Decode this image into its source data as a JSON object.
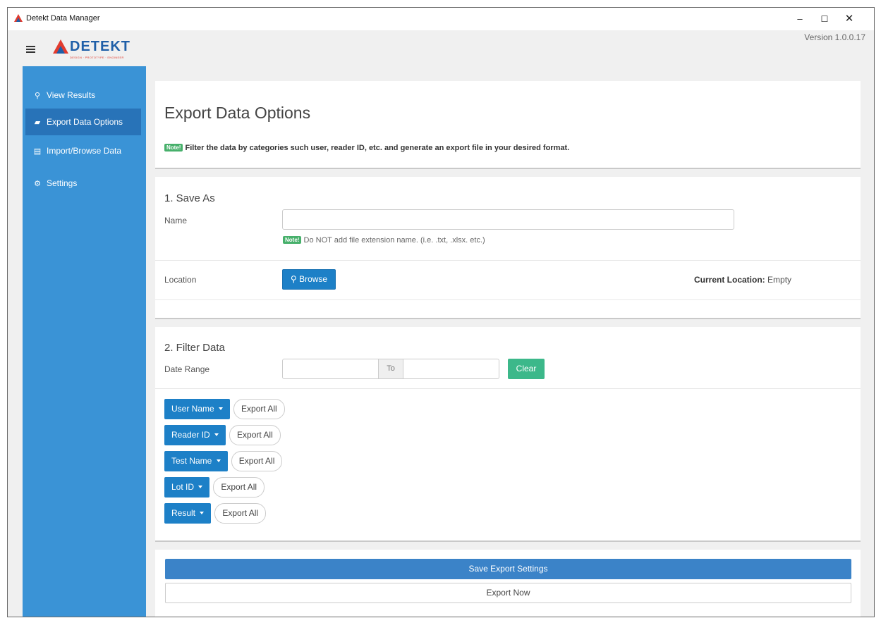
{
  "window": {
    "title": "Detekt Data Manager",
    "minimize_glyph": "–",
    "maximize_glyph": "☐",
    "close_glyph": "✕"
  },
  "header": {
    "logo_text": "DETEKT",
    "logo_tagline": "DESIGN · PROTOTYPE · ENGINEER",
    "version": "Version 1.0.0.17"
  },
  "sidebar": {
    "items": [
      {
        "label": "View Results",
        "icon": "search-icon",
        "glyph": "⚲"
      },
      {
        "label": "Export Data Options",
        "icon": "book-icon",
        "glyph": "▰",
        "active": true
      },
      {
        "label": "Import/Browse Data",
        "icon": "database-icon",
        "glyph": "▤"
      },
      {
        "label": "Settings",
        "icon": "gear-icon",
        "glyph": "⚙"
      }
    ]
  },
  "main": {
    "title": "Export Data Options",
    "note_badge": "Note!",
    "note_text": "Filter the data by categories such user, reader ID, etc. and generate an export file in your desired format.",
    "save_as": {
      "title": "1. Save As",
      "name_label": "Name",
      "name_value": "",
      "name_help": "Do NOT add file extension name. (i.e. .txt, .xlsx. etc.)",
      "location_label": "Location",
      "browse_label": "Browse",
      "current_location_label": "Current Location:",
      "current_location_value": "Empty"
    },
    "filter": {
      "title": "2. Filter Data",
      "date_range_label": "Date Range",
      "from_value": "",
      "to_label": "To",
      "to_value": "",
      "clear_label": "Clear",
      "export_all_label": "Export All",
      "dropdowns": [
        "User Name",
        "Reader ID",
        "Test Name",
        "Lot ID",
        "Result"
      ]
    },
    "actions": {
      "save_settings_label": "Save Export Settings",
      "export_now_label": "Export Now"
    }
  }
}
